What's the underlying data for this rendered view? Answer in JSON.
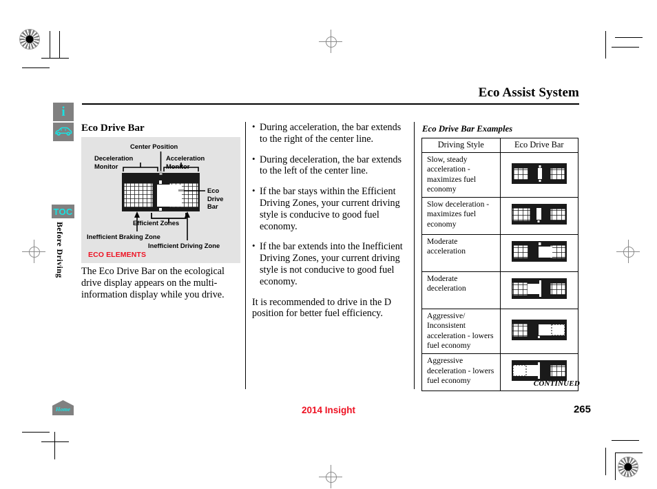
{
  "header": {
    "title": "Eco Assist System"
  },
  "rail": {
    "info_icon_glyph": "i",
    "info_icon_name": "information-icon",
    "vehicle_icon_name": "car-side-icon",
    "toc_label": "TOC",
    "section_tab_label": "Before Driving"
  },
  "left_column": {
    "heading": "Eco Drive Bar",
    "figure": {
      "caption": "ECO ELEMENTS",
      "labels": {
        "center_position": "Center Position",
        "deceleration_monitor": "Deceleration\nMonitor",
        "acceleration_monitor": "Acceleration\nMonitor",
        "eco_drive_bar": "Eco\nDrive\nBar",
        "efficient_zones": "Efficient Zones",
        "inefficient_braking_zone": "Inefficient Braking Zone",
        "inefficient_driving_zone": "Inefficient Driving Zone"
      }
    },
    "body_text": "The Eco Drive Bar on the ecological drive display appears on the multi-information display while you drive."
  },
  "middle_column": {
    "bullets": [
      "During acceleration, the bar extends to the right of the center line.",
      "During deceleration, the bar extends to the left of the center line.",
      "If the bar stays within the Efficient Driving Zones, your current driving style is conducive to good fuel economy.",
      "If the bar extends into the Inefficient Driving Zones, your current driving style is not conducive to good fuel economy."
    ],
    "closing_paragraph": "It is recommended to drive in the D position for better fuel efficiency."
  },
  "right_column": {
    "examples_title": "Eco Drive Bar Examples",
    "table": {
      "columns": [
        "Driving Style",
        "Eco Drive Bar"
      ],
      "rows": [
        {
          "driving_style": "Slow, steady acceleration - maximizes fuel economy",
          "bar_name": "eco-bar-slow-steady-acceleration"
        },
        {
          "driving_style": "Slow deceleration - maximizes fuel economy",
          "bar_name": "eco-bar-slow-deceleration"
        },
        {
          "driving_style": "Moderate acceleration",
          "bar_name": "eco-bar-moderate-acceleration"
        },
        {
          "driving_style": "Moderate deceleration",
          "bar_name": "eco-bar-moderate-deceleration"
        },
        {
          "driving_style": "Aggressive/ Inconsistent acceleration - lowers fuel economy",
          "bar_name": "eco-bar-aggressive-acceleration"
        },
        {
          "driving_style": "Aggressive deceleration - lowers fuel economy",
          "bar_name": "eco-bar-aggressive-deceleration"
        }
      ]
    },
    "continued_label": "CONTINUED"
  },
  "footer": {
    "home_label": "Home",
    "model": "2014 Insight",
    "page_number": "265"
  },
  "colors": {
    "accent_red": "#ee1122",
    "icon_cyan": "#19e2e2",
    "icon_gray": "#808080",
    "figure_background": "#e3e3e3"
  }
}
